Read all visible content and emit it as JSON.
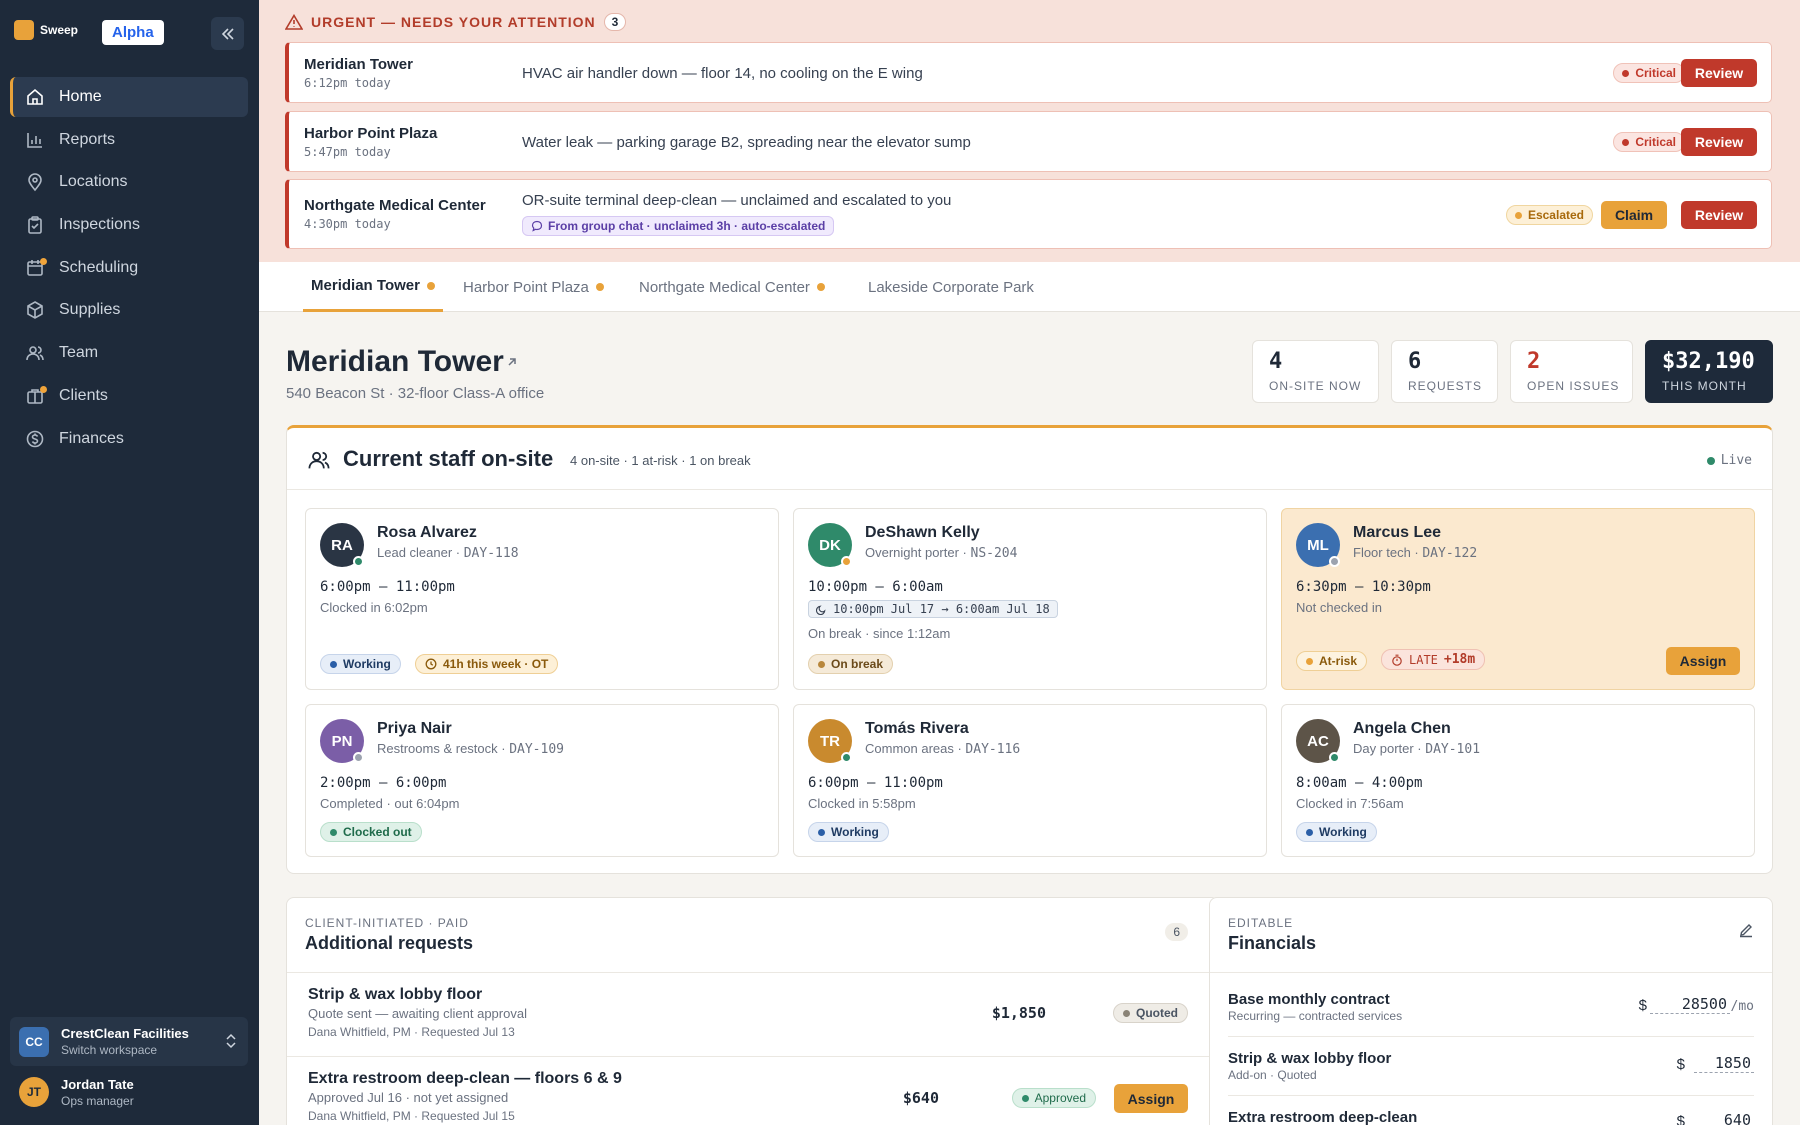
{
  "sidebar": {
    "brand": "Sweep",
    "badge": "Alpha",
    "nav": [
      {
        "label": "Home",
        "icon": "home-icon",
        "active": true
      },
      {
        "label": "Reports",
        "icon": "chart-icon"
      },
      {
        "label": "Locations",
        "icon": "pin-icon"
      },
      {
        "label": "Inspections",
        "icon": "clipboard-icon"
      },
      {
        "label": "Scheduling",
        "icon": "calendar-icon",
        "dot": true
      },
      {
        "label": "Supplies",
        "icon": "box-icon"
      },
      {
        "label": "Team",
        "icon": "people-icon"
      },
      {
        "label": "Clients",
        "icon": "briefcase-icon",
        "dot": true
      },
      {
        "label": "Finances",
        "icon": "dollar-icon"
      }
    ],
    "workspace": {
      "initials": "CC",
      "name": "CrestClean Facilities",
      "sub": "Switch workspace"
    },
    "user": {
      "initials": "JT",
      "name": "Jordan Tate",
      "role": "Ops manager"
    }
  },
  "urgent": {
    "heading": "URGENT — NEEDS YOUR ATTENTION",
    "count": "3",
    "alerts": [
      {
        "title": "Meridian Tower",
        "time": "6:12pm today",
        "message": "HVAC air handler down — floor 14, no cooling on the E wing",
        "severity": "Critical",
        "review": "Review"
      },
      {
        "title": "Harbor Point Plaza",
        "time": "5:47pm today",
        "message": "Water leak — parking garage B2, spreading near the elevator sump",
        "severity": "Critical",
        "review": "Review"
      },
      {
        "title": "Northgate Medical Center",
        "time": "4:30pm today",
        "message": "OR-suite terminal deep-clean — unclaimed and escalated to you",
        "chip": "From group chat · unclaimed 3h · auto-escalated",
        "severity": "Escalated",
        "claim": "Claim",
        "review": "Review"
      }
    ]
  },
  "tabs": [
    {
      "label": "Meridian Tower",
      "dot": true,
      "active": true
    },
    {
      "label": "Harbor Point Plaza",
      "dot": true
    },
    {
      "label": "Northgate Medical Center",
      "dot": true
    },
    {
      "label": "Lakeside Corporate Park",
      "dot": false
    }
  ],
  "location": {
    "title": "Meridian Tower",
    "subtitle": "540 Beacon St · 32-floor Class-A office",
    "stats": [
      {
        "value": "4",
        "label": "ON-SITE NOW"
      },
      {
        "value": "6",
        "label": "REQUESTS"
      },
      {
        "value": "2",
        "label": "OPEN ISSUES"
      },
      {
        "value": "$32,190",
        "label": "THIS MONTH"
      }
    ]
  },
  "staff": {
    "title": "Current staff on-site",
    "meta": "4 on-site · 1 at-risk · 1 on break",
    "live": "Live",
    "cards": [
      {
        "initials": "RA",
        "name": "Rosa Alvarez",
        "role": "Lead cleaner · ",
        "code": "DAY-118",
        "shift": "6:00pm – 11:00pm",
        "status": "Clocked in 6:02pm",
        "pill": "Working",
        "pill2": "41h this week · OT",
        "color": "#2a3544"
      },
      {
        "initials": "DK",
        "name": "DeShawn Kelly",
        "role": "Overnight porter · ",
        "code": "NS-204",
        "shift": "10:00pm – 6:00am",
        "range": "10:00pm Jul 17 → 6:00am Jul 18",
        "status": "On break · since 1:12am",
        "pill": "On break",
        "color": "#2f8a6a"
      },
      {
        "initials": "ML",
        "name": "Marcus Lee",
        "role": "Floor tech · ",
        "code": "DAY-122",
        "shift": "6:30pm – 10:30pm",
        "status": "Not checked in",
        "pill": "At-risk",
        "late_label": "LATE",
        "late_value": "+18m",
        "assign": "Assign",
        "color": "#3b6fb0"
      },
      {
        "initials": "PN",
        "name": "Priya Nair",
        "role": "Restrooms & restock · ",
        "code": "DAY-109",
        "shift": "2:00pm – 6:00pm",
        "status": "Completed · out 6:04pm",
        "pill": "Clocked out",
        "color": "#7b5ea7"
      },
      {
        "initials": "TR",
        "name": "Tomás Rivera",
        "role": "Common areas · ",
        "code": "DAY-116",
        "shift": "6:00pm – 11:00pm",
        "status": "Clocked in 5:58pm",
        "pill": "Working",
        "color": "#c98a2e"
      },
      {
        "initials": "AC",
        "name": "Angela Chen",
        "role": "Day porter · ",
        "code": "DAY-101",
        "shift": "8:00am – 4:00pm",
        "status": "Clocked in 7:56am",
        "pill": "Working",
        "color": "#5d5448"
      }
    ]
  },
  "requests": {
    "eyebrow": "CLIENT-INITIATED · PAID",
    "title": "Additional requests",
    "count": "6",
    "items": [
      {
        "title": "Strip & wax lobby floor",
        "sub": "Quote sent — awaiting client approval",
        "meta": "Dana Whitfield, PM · Requested Jul 13",
        "price": "$1,850",
        "status": "Quoted"
      },
      {
        "title": "Extra restroom deep-clean — floors 6 & 9",
        "sub": "Approved Jul 16 · not yet assigned",
        "meta": "Dana Whitfield, PM · Requested Jul 15",
        "price": "$640",
        "status": "Approved",
        "assign": "Assign"
      }
    ]
  },
  "financials": {
    "eyebrow": "EDITABLE",
    "title": "Financials",
    "rows": [
      {
        "label": "Base monthly contract",
        "sub": "Recurring — contracted services",
        "currency": "$",
        "value": "28500",
        "unit": "/mo"
      },
      {
        "label": "Strip & wax lobby floor",
        "sub": "Add-on · Quoted",
        "currency": "$",
        "value": "1850"
      },
      {
        "label": "Extra restroom deep-clean",
        "currency": "$",
        "value": "640"
      }
    ]
  }
}
